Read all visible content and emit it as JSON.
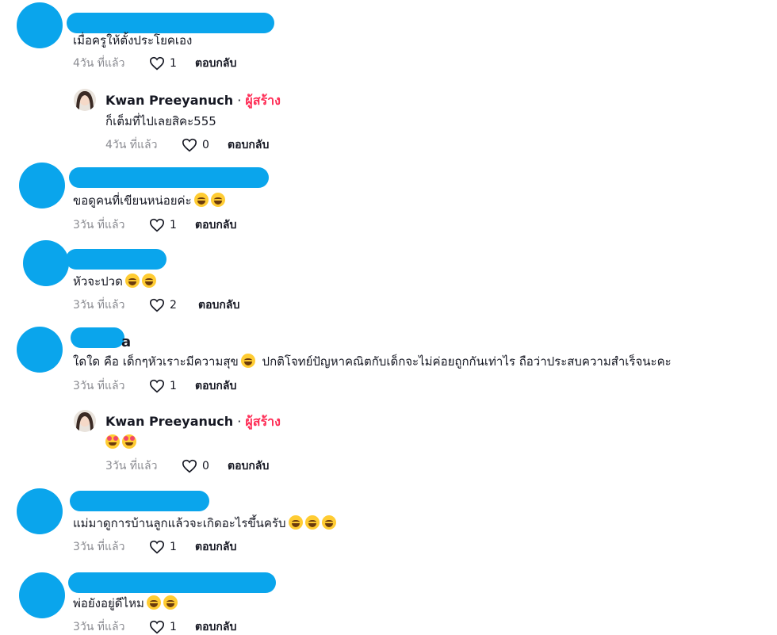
{
  "comments": [
    {
      "text": "เมื่อครูให้ตั้งประโยคเอง",
      "time": "4วัน ที่แล้ว",
      "likes": "1",
      "reply_label": "ตอบกลับ",
      "reply": {
        "name": "Kwan Preeyanuch",
        "separator": "·",
        "badge": "ผู้สร้าง",
        "text": "ก็เต็มที่ไปเลยสิคะ555",
        "time": "4วัน ที่แล้ว",
        "likes": "0",
        "reply_label": "ตอบกลับ"
      }
    },
    {
      "text": "ขอดูคนที่เขียนหน่อยค่ะ",
      "time": "3วัน ที่แล้ว",
      "likes": "1",
      "reply_label": "ตอบกลับ"
    },
    {
      "text": "หัวจะปวด",
      "time": "3วัน ที่แล้ว",
      "likes": "2",
      "reply_label": "ตอบกลับ"
    },
    {
      "name_tail": "a",
      "text": "ใดใด คือ เด็กๆหัวเราะมีความสุข",
      "text2": "ปกติโจทย์ปัญหาคณิตกับเด็กจะไม่ค่อยถูกกันเท่าไร ถือว่าประสบความสำเร็จนะคะ",
      "time": "3วัน ที่แล้ว",
      "likes": "1",
      "reply_label": "ตอบกลับ",
      "reply": {
        "name": "Kwan Preeyanuch",
        "separator": "·",
        "badge": "ผู้สร้าง",
        "time": "3วัน ที่แล้ว",
        "likes": "0",
        "reply_label": "ตอบกลับ"
      }
    },
    {
      "text": "แม่มาดูการบ้านลูกแล้วจะเกิดอะไรขึ้นครับ",
      "time": "3วัน ที่แล้ว",
      "likes": "1",
      "reply_label": "ตอบกลับ"
    },
    {
      "text": "พ่อยังอยู่ดีไหม",
      "time": "3วัน ที่แล้ว",
      "likes": "1",
      "reply_label": "ตอบกลับ"
    }
  ],
  "icons": {
    "like": "heart-outline-icon",
    "emoji_laugh": "laughing-emoji-icon",
    "emoji_grin": "grinning-emoji-icon",
    "emoji_love": "hearts-face-emoji-icon"
  },
  "colors": {
    "redaction": "#0aa5ec",
    "creator_badge": "#fe2c55",
    "muted": "#8a8b91"
  }
}
